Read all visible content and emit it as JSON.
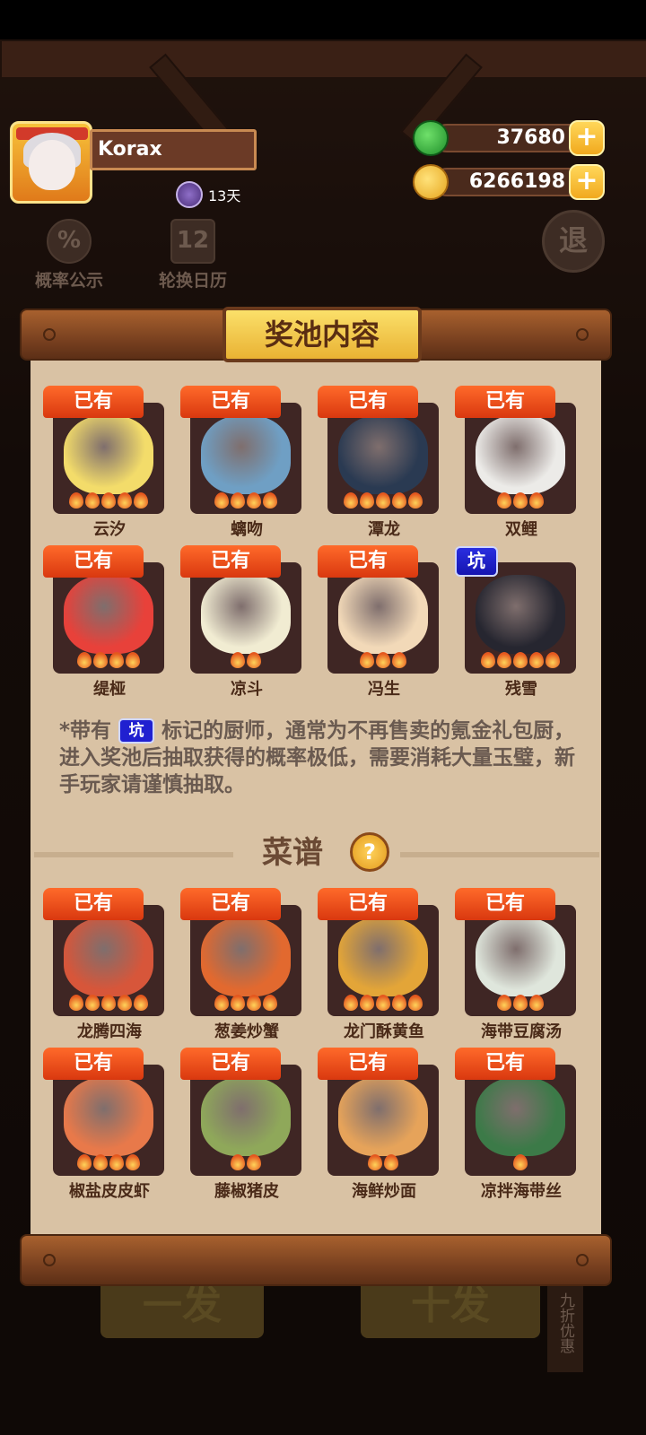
{
  "player": {
    "name": "Korax",
    "days": "13天"
  },
  "currency": {
    "jade": "37680",
    "coins": "6266198",
    "add_label": "+"
  },
  "side": {
    "probability_label": "概率公示",
    "probability_icon": "%",
    "rotation_label": "轮换日历",
    "rotation_icon": "12",
    "quit_label": "退"
  },
  "bottom": {
    "single_label": "一发",
    "ten_label": "十发",
    "discount_label": "九折优惠"
  },
  "panel": {
    "title": "奖池内容",
    "chefs": [
      {
        "badge": "已有",
        "name": "云汐",
        "flames": 5,
        "color": "#f3dc6a"
      },
      {
        "badge": "已有",
        "name": "螭吻",
        "flames": 4,
        "color": "#6f9fc4"
      },
      {
        "badge": "已有",
        "name": "潭龙",
        "flames": 5,
        "color": "#2a3a52"
      },
      {
        "badge": "已有",
        "name": "双鲤",
        "flames": 3,
        "color": "#ecebe8"
      },
      {
        "badge": "已有",
        "name": "缇桠",
        "flames": 4,
        "color": "#e8413a"
      },
      {
        "badge": "已有",
        "name": "凉斗",
        "flames": 2,
        "color": "#f1ecd2"
      },
      {
        "badge": "已有",
        "name": "冯生",
        "flames": 3,
        "color": "#f2d9b8"
      },
      {
        "badge": "坑",
        "name": "残雪",
        "flames": 5,
        "color": "#262630"
      }
    ],
    "note_prefix": "*带有",
    "note_pit": "坑",
    "note_suffix": "标记的厨师，通常为不再售卖的氪金礼包厨，进入奖池后抽取获得的概率极低，需要消耗大量玉璧，新手玩家请谨慎抽取。",
    "recipes_title": "菜谱",
    "recipes_help": "?",
    "recipes": [
      {
        "badge": "已有",
        "name": "龙腾四海",
        "flames": 5,
        "color": "#d7563a"
      },
      {
        "badge": "已有",
        "name": "葱姜炒蟹",
        "flames": 4,
        "color": "#e2692f"
      },
      {
        "badge": "已有",
        "name": "龙门酥黄鱼",
        "flames": 5,
        "color": "#e3a538"
      },
      {
        "badge": "已有",
        "name": "海带豆腐汤",
        "flames": 3,
        "color": "#dfe6dc"
      },
      {
        "badge": "已有",
        "name": "椒盐皮皮虾",
        "flames": 4,
        "color": "#e8794a"
      },
      {
        "badge": "已有",
        "name": "藤椒猪皮",
        "flames": 2,
        "color": "#8fa85a"
      },
      {
        "badge": "已有",
        "name": "海鲜炒面",
        "flames": 2,
        "color": "#e6a35a"
      },
      {
        "badge": "已有",
        "name": "凉拌海带丝",
        "flames": 1,
        "color": "#3c7a48"
      }
    ]
  }
}
